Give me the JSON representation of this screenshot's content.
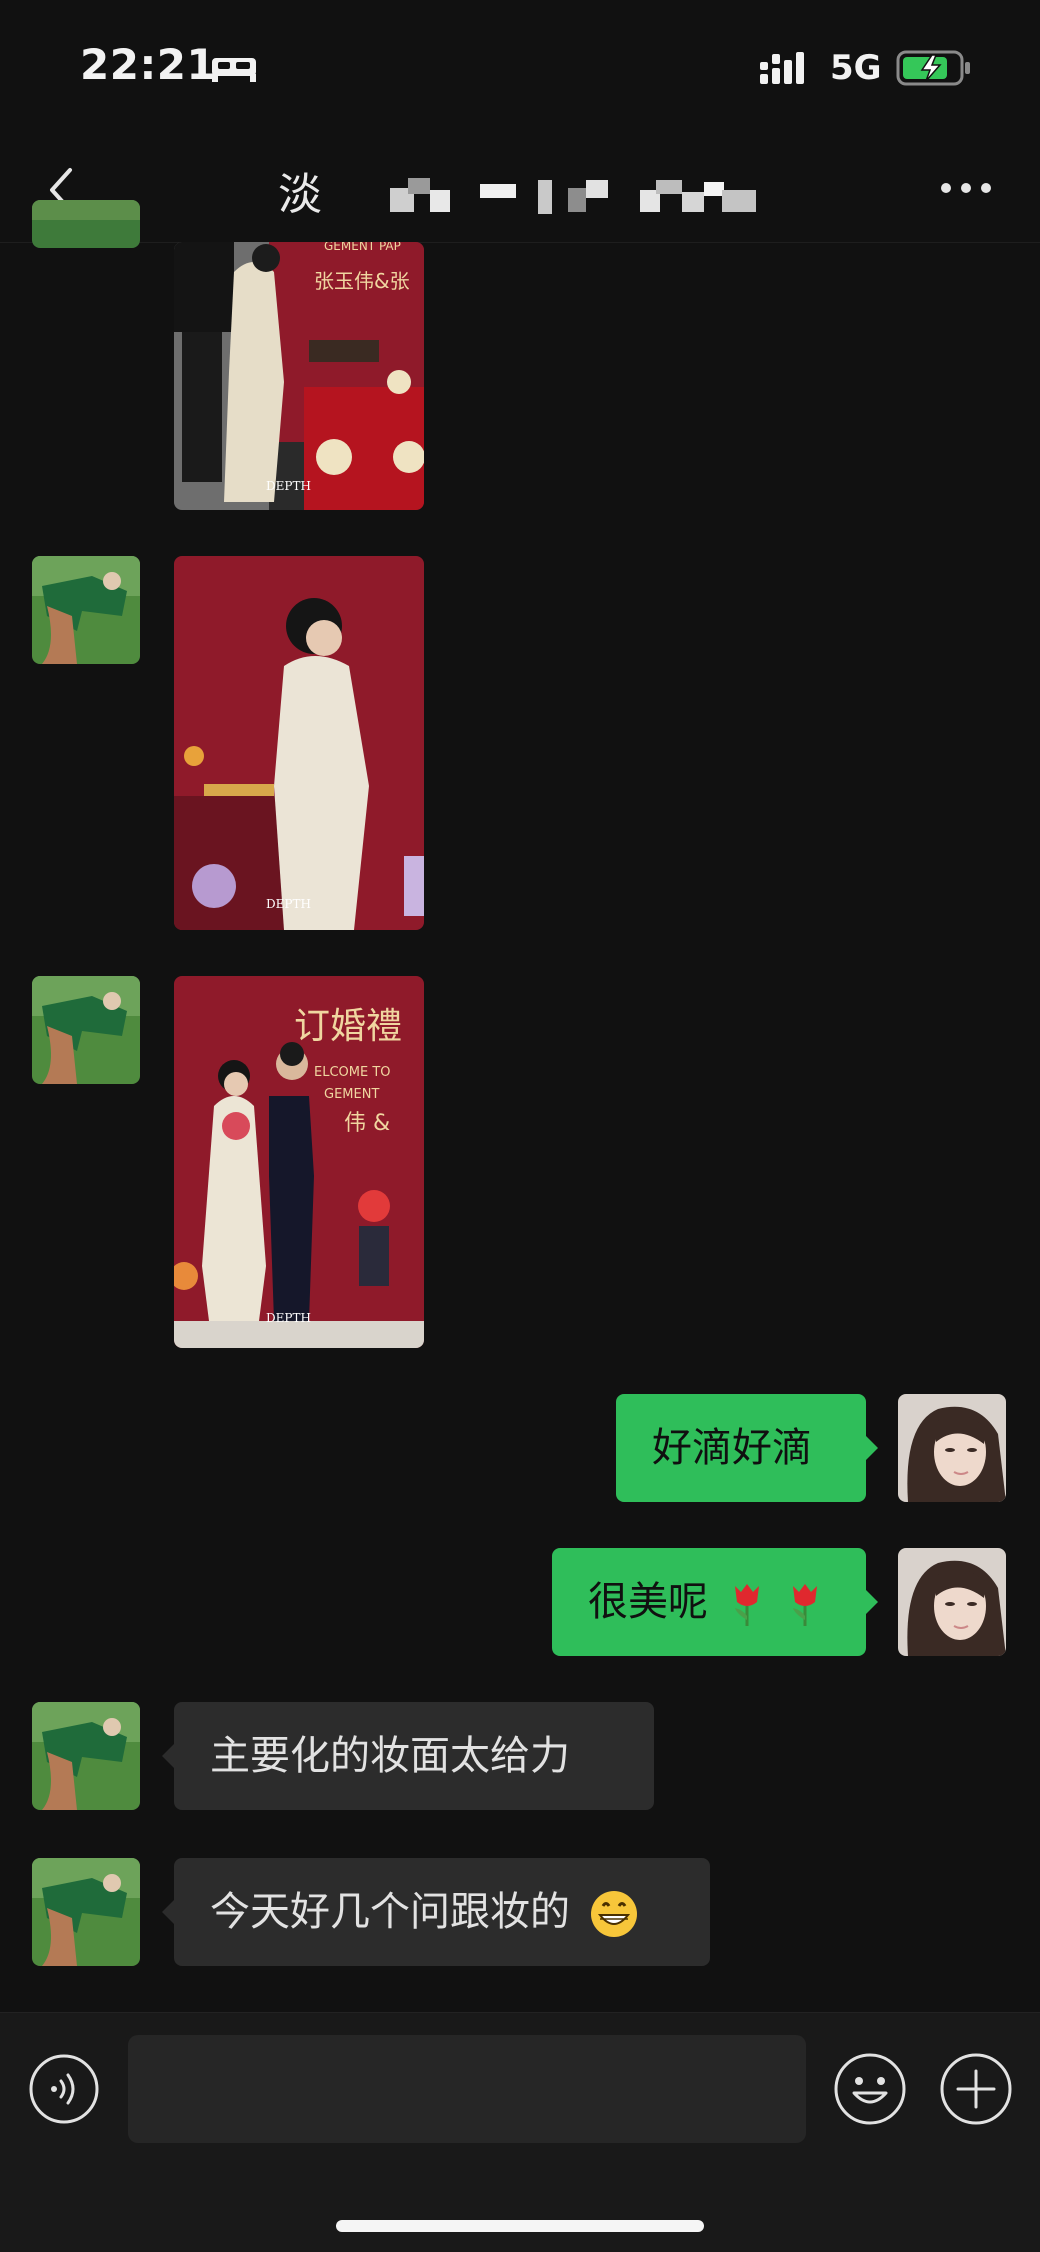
{
  "status_bar": {
    "time": "22:21",
    "network": "5G",
    "icons": [
      "bed-icon",
      "signal-icon",
      "battery-charging-icon"
    ]
  },
  "nav": {
    "back_icon": "chevron-left-icon",
    "title": "淡",
    "more_icon": "more-dots-icon"
  },
  "messages": [
    {
      "sender": "other",
      "type": "image",
      "photo_caption": "DEPTH"
    },
    {
      "sender": "other",
      "type": "image",
      "photo_caption": "DEPTH"
    },
    {
      "sender": "other",
      "type": "image",
      "photo_caption": "DEPTH",
      "photo_sign": "订婚禮",
      "photo_sub": "ELCOME TO",
      "photo_sub2": "GEMENT",
      "photo_names": "伟 &"
    },
    {
      "sender": "me",
      "type": "text",
      "text": "好滴好滴"
    },
    {
      "sender": "me",
      "type": "text",
      "text": "很美呢",
      "emoji": [
        "tulip-icon",
        "tulip-icon"
      ]
    },
    {
      "sender": "other",
      "type": "text",
      "text": "主要化的妆面太给力"
    },
    {
      "sender": "other",
      "type": "text",
      "text": "今天好几个问跟妆的",
      "emoji": [
        "grin-icon"
      ]
    }
  ],
  "photo_top_sign": "GEMENT PAP",
  "photo_top_names": "张玉伟&张",
  "input_bar": {
    "voice_icon": "voice-icon",
    "placeholder": "",
    "emoji_icon": "smiley-icon",
    "add_icon": "plus-circle-icon"
  },
  "colors": {
    "background": "#111111",
    "incoming_bubble": "#2c2c2c",
    "outgoing_bubble": "#2fbe5a",
    "photo_red": "#8f1a2a"
  }
}
